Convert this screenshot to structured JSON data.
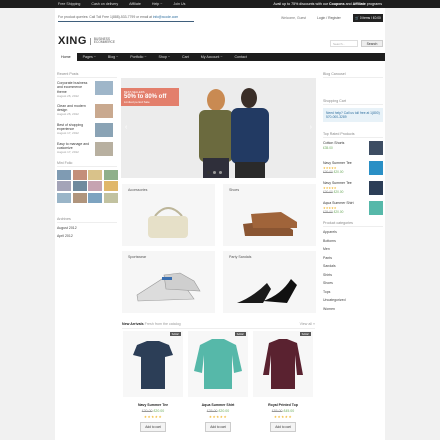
{
  "topbar": {
    "links": [
      "Free Shipping",
      "Cash on delivery",
      "Affiliate",
      "Help ~",
      "Join Us"
    ],
    "promo_prefix": "Avail up to 75% discounts with our ",
    "promo_coupons": "Coupons",
    "promo_and": " and ",
    "promo_affiliate": "Affiliate",
    "promo_suffix": " programs"
  },
  "header": {
    "contact_text": "For product queries: Call Toll Free 1(888)-533-7799 or email at ",
    "contact_email": "info@xcode.com",
    "welcome": "Welcome, Guest",
    "account": "Login / Register",
    "cart": "0 items / £0.00",
    "logo": "XING",
    "logo_tag1": "BUSINESS",
    "logo_tag2": "ECOMMERCE",
    "search_placeholder": "Search...",
    "search_button": "Search"
  },
  "nav": [
    "Home",
    "Pages ~",
    "Blog ~",
    "Portfolio ~",
    "Shop ~",
    "Cart",
    "My Account ~",
    "Contact"
  ],
  "left": {
    "recent_title": "Recent Posts",
    "posts": [
      {
        "title": "Corporate business and ecommerce theme",
        "date": "August 26, 2012"
      },
      {
        "title": "Clean and modern design",
        "date": "August 26, 2012"
      },
      {
        "title": "Best of shopping experience",
        "date": "August 17, 2012"
      },
      {
        "title": "Easy to manage and customize",
        "date": "August 17, 2012"
      }
    ],
    "flickr_title": "Mini Folio",
    "archives_title": "Archives",
    "archives": [
      "August 2012",
      "April 2012"
    ]
  },
  "slider": {
    "kicker": "BEST-SELLERS",
    "headline": "50% to 80% off",
    "sub": "Limited period Sale"
  },
  "categories": [
    "Accessories",
    "Shoes",
    "Sportswear",
    "Party Sandals"
  ],
  "arrivals": {
    "title": "New Arrivals",
    "sub": "Fresh from the catalog",
    "view_all": "View all »",
    "products": [
      {
        "name": "Navy Summer Tee",
        "old": "£30.00",
        "new": "£20.00",
        "sale": "SALE!",
        "stars": "★★★★★",
        "add": "Add to cart"
      },
      {
        "name": "Aqua Summer Shirt",
        "old": "£35.00",
        "new": "£20.00",
        "sale": "SALE!",
        "stars": "★★★★★",
        "add": "Add to cart"
      },
      {
        "name": "Royal Printed Top",
        "old": "£55.00",
        "new": "£45.00",
        "sale": "SALE!",
        "stars": "★★★★★",
        "add": "Add to cart"
      }
    ]
  },
  "right": {
    "blog_title": "Blog Carousel",
    "cart_title": "Shopping Cart",
    "notice": "Need help? Call us toll free at 1(800) 570-000-3289",
    "top_title": "Top Rated Products",
    "top": [
      {
        "name": "Cotton Shorts",
        "old": "",
        "price": "£35.00"
      },
      {
        "name": "Navy Summer Tee",
        "old": "£30.00",
        "price": "£20.00"
      },
      {
        "name": "Navy Summer Tee",
        "old": "£30.00",
        "price": "£20.00"
      },
      {
        "name": "Aqua Summer Shirt",
        "old": "£35.00",
        "price": "£20.00"
      }
    ],
    "cat_title": "Product categories",
    "cats": [
      "Apparels",
      "Bottoms",
      "Men",
      "Pants",
      "Sandals",
      "Shirts",
      "Shoes",
      "Tops",
      "Uncategorized",
      "Women"
    ]
  },
  "colors": {
    "accent": "#e37f6c",
    "dark": "#1d1d1d",
    "link": "#2f6f9f",
    "price": "#6aa85a"
  }
}
